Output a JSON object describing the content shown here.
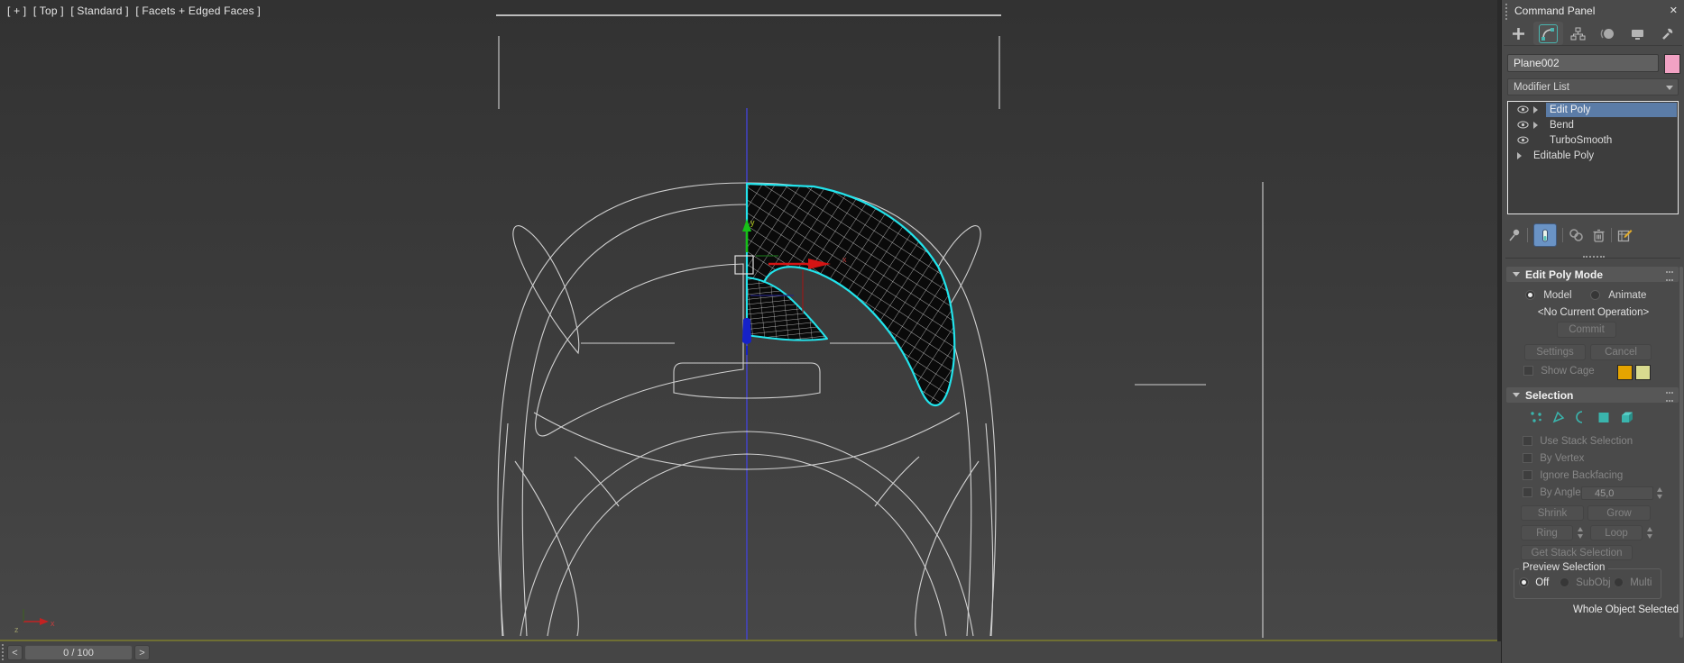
{
  "viewport": {
    "label": {
      "plus": "[ + ]",
      "view": "[ Top ]",
      "render": "[ Standard ]",
      "shading": "[ Facets + Edged Faces ]"
    },
    "colors": {
      "wireframe": "#dcdcdc",
      "selection_cyan": "#22e4ec",
      "axis_line_blue": "#4343d2",
      "gizmo_green": "#17c017",
      "gizmo_red": "#d41414"
    }
  },
  "time_slider": {
    "prev": "<",
    "value": "0 / 100",
    "next": ">"
  },
  "panel": {
    "title": "Command Panel",
    "close_glyph": "✕",
    "tabs": [
      {
        "label": "Create",
        "icon": "plus-icon"
      },
      {
        "label": "Modify",
        "icon": "modify-icon",
        "selected": true
      },
      {
        "label": "Hierarchy",
        "icon": "hierarchy-icon"
      },
      {
        "label": "Motion",
        "icon": "motion-icon"
      },
      {
        "label": "Display",
        "icon": "display-icon"
      },
      {
        "label": "Utilities",
        "icon": "wrench-icon"
      }
    ],
    "object_name": "Plane002",
    "object_color": "#f2a2c4",
    "modifier_list_label": "Modifier List",
    "stack": [
      {
        "label": "Edit Poly",
        "eye": true,
        "expandable": true,
        "selected": true
      },
      {
        "label": "Bend",
        "eye": true,
        "expandable": true,
        "selected": false
      },
      {
        "label": "TurboSmooth",
        "eye": true,
        "expandable": false,
        "selected": false
      },
      {
        "label": "Editable Poly",
        "eye": false,
        "expandable": true,
        "selected": false
      }
    ],
    "stack_tools": [
      "pin-stack",
      "show-end-result",
      "make-unique",
      "remove-modifier",
      "configure-modifier-sets"
    ],
    "edit_poly_mode": {
      "title": "Edit Poly Mode",
      "radio_model": "Model",
      "radio_animate": "Animate",
      "operation": "<No Current Operation>",
      "commit": "Commit",
      "settings": "Settings",
      "cancel": "Cancel",
      "show_cage": "Show Cage",
      "cage_color_1": "#e5a400",
      "cage_color_2": "#d9db8f"
    },
    "selection": {
      "title": "Selection",
      "subobject_icons": [
        "vertex-icon",
        "edge-icon",
        "border-icon",
        "polygon-icon",
        "element-icon"
      ],
      "use_stack_selection": "Use Stack Selection",
      "by_vertex": "By Vertex",
      "ignore_backfacing": "Ignore Backfacing",
      "by_angle": "By Angle:",
      "by_angle_value": "45,0",
      "shrink": "Shrink",
      "grow": "Grow",
      "ring": "Ring",
      "loop": "Loop",
      "get_stack_selection": "Get Stack Selection",
      "preview_selection": "Preview Selection",
      "off": "Off",
      "subobj": "SubObj",
      "multi": "Multi",
      "status": "Whole Object Selected"
    },
    "colors": {
      "accent_teal": "#3ab5ad",
      "selection_blue": "#5b7ca7",
      "show_end_result_blue": "#6a93c5"
    }
  }
}
